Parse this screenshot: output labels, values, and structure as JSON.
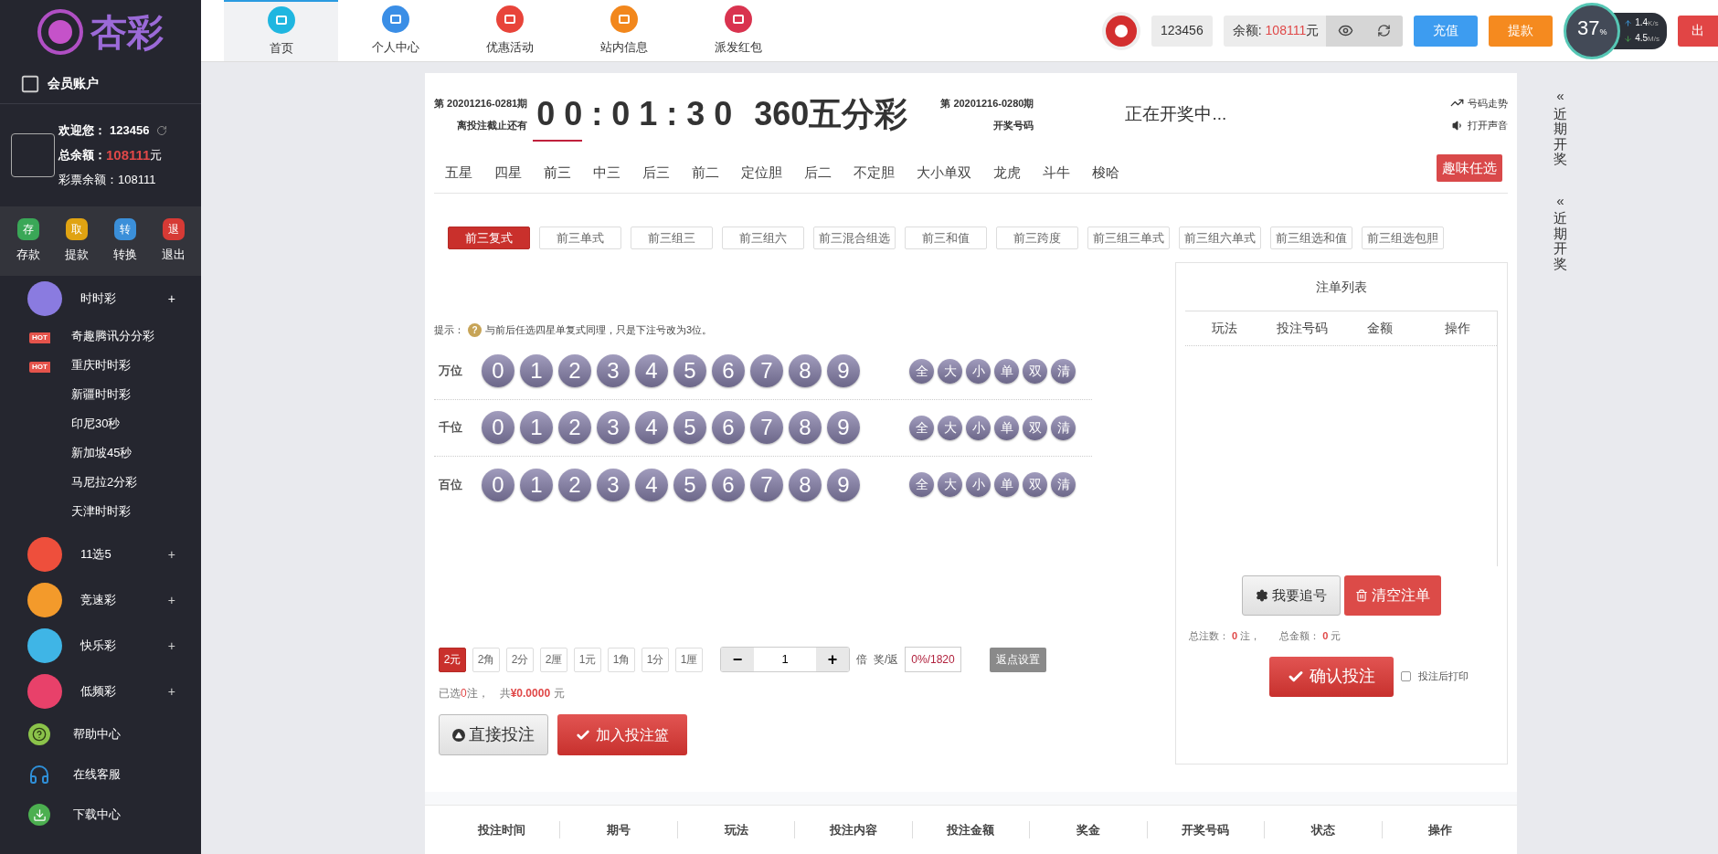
{
  "sidebar": {
    "logo": "杏彩",
    "member_account": "会员账户",
    "user": {
      "welcome_label": "欢迎您：",
      "username": "123456",
      "total_label": "总余额：",
      "total": "108111",
      "total_unit": "元",
      "lottery_label": "彩票余额：",
      "lottery_balance": "108111"
    },
    "quick_actions": [
      {
        "icon": "存",
        "label": "存款",
        "color": "#3aa757"
      },
      {
        "icon": "取",
        "label": "提款",
        "color": "#e0a312"
      },
      {
        "icon": "转",
        "label": "转换",
        "color": "#3b8fd9"
      },
      {
        "icon": "退",
        "label": "退出",
        "color": "#d63a35"
      }
    ],
    "categories": [
      {
        "name": "时时彩",
        "toggle": "+",
        "color": "#8a7be0",
        "expanded": true,
        "children": [
          {
            "name": "奇趣腾讯分分彩",
            "badge": "HOT"
          },
          {
            "name": "重庆时时彩",
            "badge": "HOT"
          },
          {
            "name": "新疆时时彩"
          },
          {
            "name": "印尼30秒"
          },
          {
            "name": "新加坡45秒"
          },
          {
            "name": "马尼拉2分彩"
          },
          {
            "name": "天津时时彩"
          }
        ]
      },
      {
        "name": "11选5",
        "toggle": "+",
        "color": "#ee4f3c",
        "expanded": false
      },
      {
        "name": "竞速彩",
        "toggle": "+",
        "color": "#f39a2b",
        "expanded": false
      },
      {
        "name": "快乐彩",
        "toggle": "+",
        "color": "#3fb5e6",
        "expanded": false
      },
      {
        "name": "低频彩",
        "toggle": "+",
        "color": "#e8416a",
        "expanded": false
      }
    ],
    "links": [
      {
        "kind": "help",
        "label": "帮助中心"
      },
      {
        "kind": "service",
        "label": "在线客服"
      },
      {
        "kind": "download",
        "label": "下载中心"
      }
    ]
  },
  "top_nav": [
    {
      "label": "首页",
      "selected": true,
      "color": "#1fb6e0"
    },
    {
      "label": "个人中心",
      "selected": false,
      "color": "#3a8ee6"
    },
    {
      "label": "优惠活动",
      "selected": false,
      "color": "#e8443a"
    },
    {
      "label": "站内信息",
      "selected": false,
      "color": "#f2871c"
    },
    {
      "label": "派发红包",
      "selected": false,
      "color": "#d9334f"
    }
  ],
  "account_bar": {
    "username": "123456",
    "balance_label": "余额:",
    "balance": "108111",
    "balance_unit": "元",
    "buttons": [
      {
        "kind": "blue",
        "label": "充值"
      },
      {
        "kind": "orange",
        "label": "提款"
      },
      {
        "kind": "red",
        "label": "出"
      }
    ]
  },
  "net_widget": {
    "percent": "37",
    "percent_sign": "%",
    "up": "1.4",
    "up_unit": "K/s",
    "down": "4.5",
    "down_unit": "M/s"
  },
  "game": {
    "issue": "第 20201216-0281期",
    "deadline_label": "离投注截止还有",
    "countdown": "00:01:30",
    "name": "360五分彩",
    "prev_issue": "第 20201216-0280期",
    "draw_label": "开奖号码",
    "draw_status": "正在开奖中...",
    "trend_link": "号码走势",
    "sound_link": "打开声音"
  },
  "play_tabs": [
    {
      "label": "五星",
      "selected": false
    },
    {
      "label": "四星",
      "selected": false
    },
    {
      "label": "前三",
      "selected": true
    },
    {
      "label": "中三",
      "selected": false
    },
    {
      "label": "后三",
      "selected": false
    },
    {
      "label": "前二",
      "selected": false
    },
    {
      "label": "定位胆",
      "selected": false
    },
    {
      "label": "后二",
      "selected": false
    },
    {
      "label": "不定胆",
      "selected": false
    },
    {
      "label": "大小单双",
      "selected": false
    },
    {
      "label": "龙虎",
      "selected": false
    },
    {
      "label": "斗牛",
      "selected": false
    },
    {
      "label": "梭哈",
      "selected": false
    }
  ],
  "fun_button": "趣味任选",
  "sub_plays": [
    {
      "label": "前三复式",
      "selected": true
    },
    {
      "label": "前三单式",
      "selected": false
    },
    {
      "label": "前三组三",
      "selected": false
    },
    {
      "label": "前三组六",
      "selected": false
    },
    {
      "label": "前三混合组选",
      "selected": false
    },
    {
      "label": "前三和值",
      "selected": false
    },
    {
      "label": "前三跨度",
      "selected": false
    },
    {
      "label": "前三组三单式",
      "selected": false
    },
    {
      "label": "前三组六单式",
      "selected": false
    },
    {
      "label": "前三组选和值",
      "selected": false
    },
    {
      "label": "前三组选包胆",
      "selected": false
    }
  ],
  "hint": {
    "label": "提示：",
    "icon": "?",
    "text": "与前后任选四星单复式同理，只是下注号改为3位。"
  },
  "positions": [
    {
      "label": "万位",
      "numbers": [
        "0",
        "1",
        "2",
        "3",
        "4",
        "5",
        "6",
        "7",
        "8",
        "9"
      ],
      "quick": [
        "全",
        "大",
        "小",
        "单",
        "双",
        "清"
      ]
    },
    {
      "label": "千位",
      "numbers": [
        "0",
        "1",
        "2",
        "3",
        "4",
        "5",
        "6",
        "7",
        "8",
        "9"
      ],
      "quick": [
        "全",
        "大",
        "小",
        "单",
        "双",
        "清"
      ]
    },
    {
      "label": "百位",
      "numbers": [
        "0",
        "1",
        "2",
        "3",
        "4",
        "5",
        "6",
        "7",
        "8",
        "9"
      ],
      "quick": [
        "全",
        "大",
        "小",
        "单",
        "双",
        "清"
      ]
    }
  ],
  "units": [
    {
      "label": "2元",
      "selected": true
    },
    {
      "label": "2角",
      "selected": false
    },
    {
      "label": "2分",
      "selected": false
    },
    {
      "label": "2厘",
      "selected": false
    },
    {
      "label": "1元",
      "selected": false
    },
    {
      "label": "1角",
      "selected": false
    },
    {
      "label": "1分",
      "selected": false
    },
    {
      "label": "1厘",
      "selected": false
    }
  ],
  "multiplier": {
    "minus": "−",
    "value": "1",
    "plus": "+",
    "unit": "倍"
  },
  "rebate": {
    "label": "奖/返",
    "value": "0%/1820",
    "button": "返点设置"
  },
  "summary": {
    "selected_prefix": "已选",
    "count": "0",
    "count_unit": "注，",
    "total_prefix": "共",
    "amount": "¥0.0000",
    "amount_unit": "元"
  },
  "actions": {
    "direct": "直接投注",
    "add": "加入投注篮"
  },
  "bet_list": {
    "title": "注单列表",
    "columns": [
      "玩法",
      "投注号码",
      "金额",
      "操作"
    ],
    "chase": "我要追号",
    "clear": "清空注单",
    "count_label": "总注数：",
    "count": "0",
    "count_unit": "注，",
    "amount_label": "总金额：",
    "amount": "0",
    "amount_unit": "元",
    "confirm": "确认投注",
    "print_label": "投注后打印",
    "print_checked": false
  },
  "history_columns": [
    "投注时间",
    "期号",
    "玩法",
    "投注内容",
    "投注金额",
    "奖金",
    "开奖号码",
    "状态",
    "操作"
  ],
  "right_rail": [
    {
      "arrow": "«",
      "label": "近期开奖"
    },
    {
      "arrow": "«",
      "label": "近期开奖"
    }
  ]
}
